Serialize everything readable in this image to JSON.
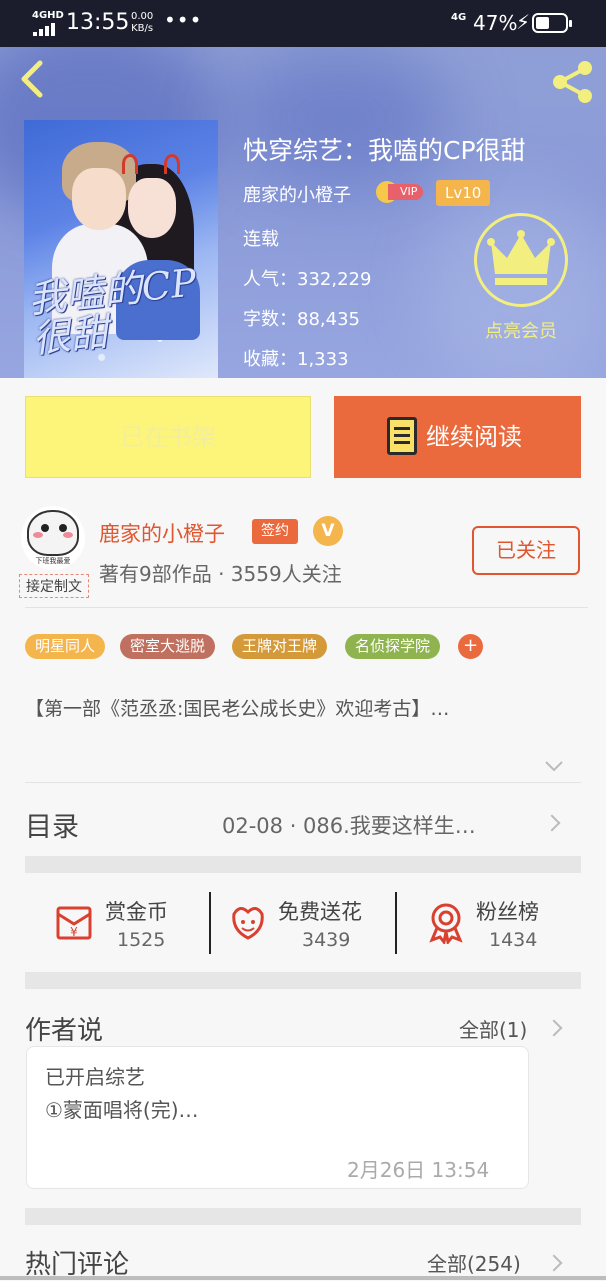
{
  "status_bar": {
    "network": "4GHD",
    "time": "13:55",
    "speed_value": "0.00",
    "speed_unit": "KB/s",
    "dots": "•••",
    "network2": "4G",
    "battery": "47%"
  },
  "book": {
    "title": "快穿综艺：我嗑的CP很甜",
    "author": "鹿家的小橙子",
    "vip": "VIP",
    "level": "Lv10",
    "status": "连载",
    "popularity": "人气：332,229",
    "word_count": "字数：88,435",
    "favorites": "收藏：1,333",
    "cover_art_text": "我嗑的CP很甜",
    "member_label": "点亮会员"
  },
  "actions": {
    "shelf_label": "已在书架",
    "read_label": "继续阅读"
  },
  "author": {
    "avatar_caption": "下班我最爱",
    "signed_tag": "接定制文",
    "name": "鹿家的小橙子",
    "sign_badge": "签约",
    "verified": "V",
    "works_line": "著有9部作品 · 3559人关注",
    "follow_label": "已关注"
  },
  "tags": [
    {
      "label": "明星同人",
      "color": "#f4b54c"
    },
    {
      "label": "密室大逃脱",
      "color": "#c0705f"
    },
    {
      "label": "王牌对王牌",
      "color": "#d49a3a"
    },
    {
      "label": "名侦探学院",
      "color": "#8fb44f"
    }
  ],
  "tag_add": "+",
  "intro": "【第一部《范丞丞:国民老公成长史》欢迎考古】…",
  "toc": {
    "label": "目录",
    "latest": "02-08 · 086.我要这样生…"
  },
  "stats": [
    {
      "label": "赏金币",
      "value": "1525",
      "icon": "money-envelope-icon"
    },
    {
      "label": "免费送花",
      "value": "3439",
      "icon": "flower-icon"
    },
    {
      "label": "粉丝榜",
      "value": "1434",
      "icon": "medal-icon"
    }
  ],
  "announcement": {
    "title": "作者说",
    "all": "全部(1)",
    "line1": "已开启综艺",
    "line2": "①蒙面唱将(完)…",
    "time": "2月26日  13:54"
  },
  "comments": {
    "title": "热门评论",
    "all": "全部(254)"
  },
  "colors": {
    "accent": "#eb6a3d",
    "shelf_button": "#fdf57a",
    "member": "#f3ee80"
  }
}
